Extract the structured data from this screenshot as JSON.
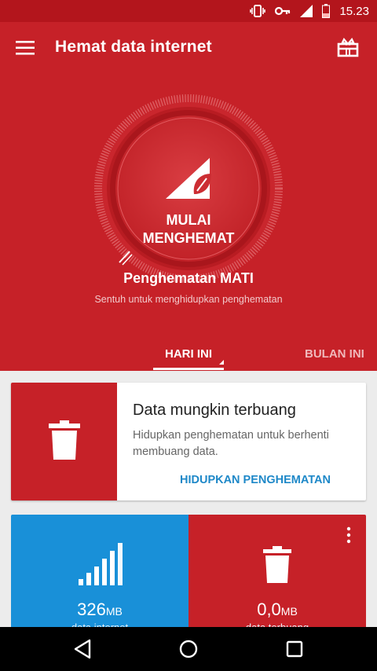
{
  "status_bar": {
    "time": "15.23"
  },
  "header": {
    "title": "Hemat data internet"
  },
  "dial": {
    "line1": "MULAI",
    "line2": "MENGHEMAT"
  },
  "status": {
    "title": "Penghematan MATI",
    "subtitle": "Sentuh untuk menghidupkan penghematan"
  },
  "tabs": [
    {
      "label": "HARI INI"
    },
    {
      "label": "BULAN INI"
    }
  ],
  "waste_card": {
    "title": "Data mungkin terbuang",
    "description": "Hidupkan penghematan untuk berhenti membuang data.",
    "action": "HIDUPKAN PENGHEMATAN"
  },
  "stats": [
    {
      "value": "326",
      "unit": "MB",
      "label": "data internet"
    },
    {
      "value": "0,0",
      "unit": "MB",
      "label": "data terbuang"
    }
  ],
  "colors": {
    "primary_red": "#c62128",
    "dark_red": "#b3151c",
    "accent_blue": "#1990d8",
    "link_blue": "#1e88c8"
  }
}
